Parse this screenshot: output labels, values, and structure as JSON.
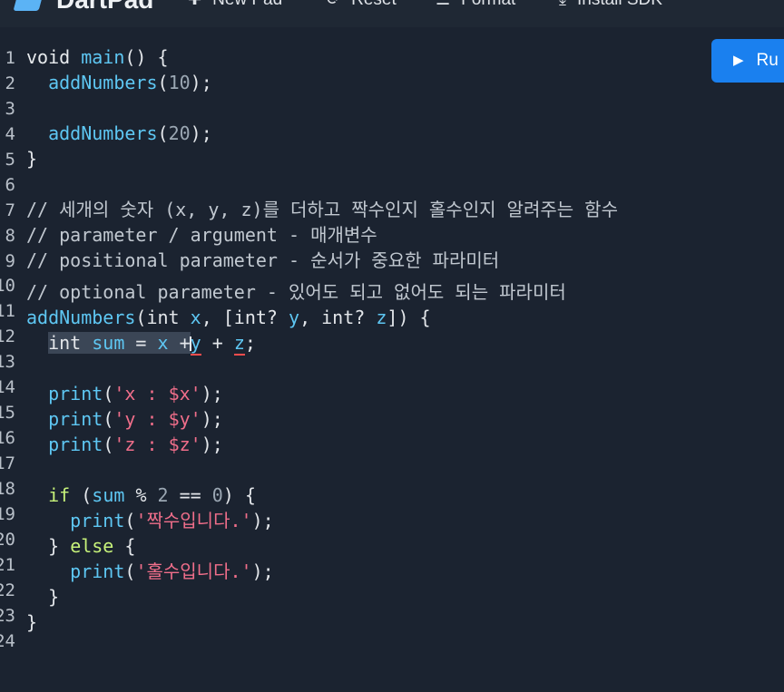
{
  "topbar": {
    "title": "DartPad",
    "new_pad": "New Pad",
    "reset": "Reset",
    "format": "Format",
    "install_sdk": "Install SDK"
  },
  "run_button": {
    "label": "Ru"
  },
  "icons": {
    "logo": "dart-logo-icon",
    "new_pad": "plus-icon",
    "reset": "refresh-icon",
    "format": "format-lines-icon",
    "install": "download-icon",
    "run": "play-icon"
  },
  "colors": {
    "background": "#1b2330",
    "accent": "#1a80ef",
    "function": "#5ec7f3",
    "string": "#f06e8a",
    "if_keyword": "#c7f27a",
    "error_underline": "#ff4d4d"
  },
  "editor": {
    "lines": [
      {
        "n": "1"
      },
      {
        "n": "2"
      },
      {
        "n": "3"
      },
      {
        "n": "4"
      },
      {
        "n": "5"
      },
      {
        "n": "6"
      },
      {
        "n": "7"
      },
      {
        "n": "8"
      },
      {
        "n": "9"
      },
      {
        "n": "10"
      },
      {
        "n": "11"
      },
      {
        "n": "12"
      },
      {
        "n": "13"
      },
      {
        "n": "14"
      },
      {
        "n": "15"
      },
      {
        "n": "16"
      },
      {
        "n": "17"
      },
      {
        "n": "18"
      },
      {
        "n": "19"
      },
      {
        "n": "20"
      },
      {
        "n": "21"
      },
      {
        "n": "22"
      },
      {
        "n": "23"
      },
      {
        "n": "24"
      }
    ],
    "tokens": {
      "l1": [
        "void",
        "main",
        "() {"
      ],
      "l2": [
        "addNumbers",
        "(",
        "10",
        ");"
      ],
      "l4": [
        "addNumbers",
        "(",
        "20",
        ");"
      ],
      "l5": [
        "}"
      ],
      "l7": "// 세개의 숫자 (x, y, z)를 더하고 짝수인지 홀수인지 알려주는 함수",
      "l8": "// parameter / argument - 매개변수",
      "l9": "// positional parameter - 순서가 중요한 파라미터",
      "l10": "// optional parameter - 있어도 되고 없어도 되는 파라미터",
      "l11": [
        "addNumbers",
        "(int ",
        "x",
        ", [int? ",
        "y",
        ", int? ",
        "z",
        "]) {"
      ],
      "l12": [
        "int ",
        "sum",
        " = ",
        "x",
        " +",
        "y",
        " + ",
        "z",
        ";"
      ],
      "l14": [
        "print",
        "(",
        "'x : $x'",
        ");"
      ],
      "l15": [
        "print",
        "(",
        "'y : $y'",
        ");"
      ],
      "l16": [
        "print",
        "(",
        "'z : $z'",
        ");"
      ],
      "l18": [
        "if",
        " (",
        "sum",
        " % ",
        "2",
        " == ",
        "0",
        ") {"
      ],
      "l19": [
        "print",
        "(",
        "'짝수입니다.'",
        ");"
      ],
      "l20": [
        "} ",
        "else",
        " {"
      ],
      "l21": [
        "print",
        "(",
        "'홀수입니다.'",
        ");"
      ],
      "l22": [
        "}"
      ],
      "l23": [
        "}"
      ]
    }
  }
}
